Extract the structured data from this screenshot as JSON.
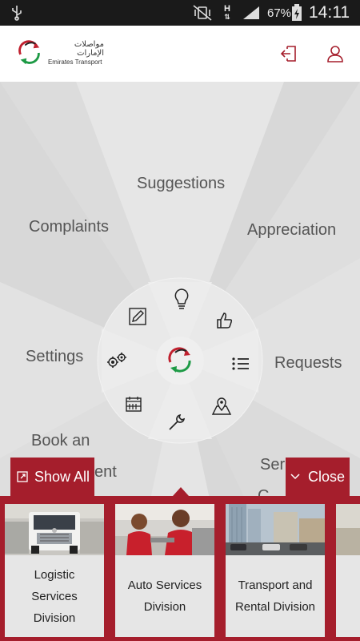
{
  "status_bar": {
    "network_type": "H",
    "battery_percent": "67%",
    "time": "14:11"
  },
  "header": {
    "logo": {
      "arabic_text": "مواصلات الإمارات",
      "english_text": "Emirates Transport"
    },
    "icons": {
      "logout": "logout-icon",
      "profile": "profile-icon"
    }
  },
  "wheel": {
    "sectors": {
      "suggestions": "Suggestions",
      "complaints": "Complaints",
      "appreciation": "Appreciation",
      "settings": "Settings",
      "requests": "Requests",
      "book_line1": "Book an",
      "book_line2": "ent",
      "services_line1": "Ser",
      "services_line2": "C"
    },
    "icons": {
      "suggestions": "lightbulb-icon",
      "appreciation": "thumbs-up-icon",
      "requests": "list-icon",
      "locations": "map-pin-icon",
      "services": "wrench-icon",
      "booking": "calendar-icon",
      "settings": "gears-icon",
      "complaints": "edit-icon",
      "center": "emirates-transport-logo"
    }
  },
  "panel": {
    "show_all_label": "Show All",
    "close_label": "Close",
    "accent_color": "#a51e2c",
    "cards": [
      {
        "title": "Logistic Services Division"
      },
      {
        "title": "Auto Services Division"
      },
      {
        "title": "Transport and Rental Division"
      },
      {
        "title": ""
      }
    ]
  }
}
